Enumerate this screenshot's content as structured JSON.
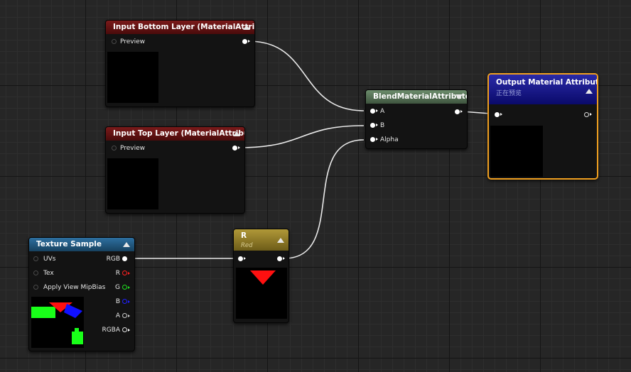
{
  "nodes": {
    "input_bottom": {
      "title": "Input Bottom Layer (MaterialAttributes)",
      "pin": "Preview"
    },
    "input_top": {
      "title": "Input Top Layer (MaterialAttributes)",
      "pin": "Preview"
    },
    "blend": {
      "title": "BlendMaterialAttributes",
      "pins": [
        "A",
        "B",
        "Alpha"
      ]
    },
    "output": {
      "title": "Output Material Attributes",
      "subtitle": "正在预览"
    },
    "texture": {
      "title": "Texture Sample",
      "inputs": [
        "UVs",
        "Tex",
        "Apply View MipBias"
      ],
      "outputs": [
        "RGB",
        "R",
        "G",
        "B",
        "A",
        "RGBA"
      ]
    },
    "mask": {
      "title": "R",
      "subtitle": "Red"
    }
  },
  "colors": {
    "pin_r": "#ff2020",
    "pin_g": "#20e020",
    "pin_b": "#2020ff",
    "pin_a": "#c8c8c8",
    "output_border": "#f0a020",
    "wire": "#ffffff"
  }
}
